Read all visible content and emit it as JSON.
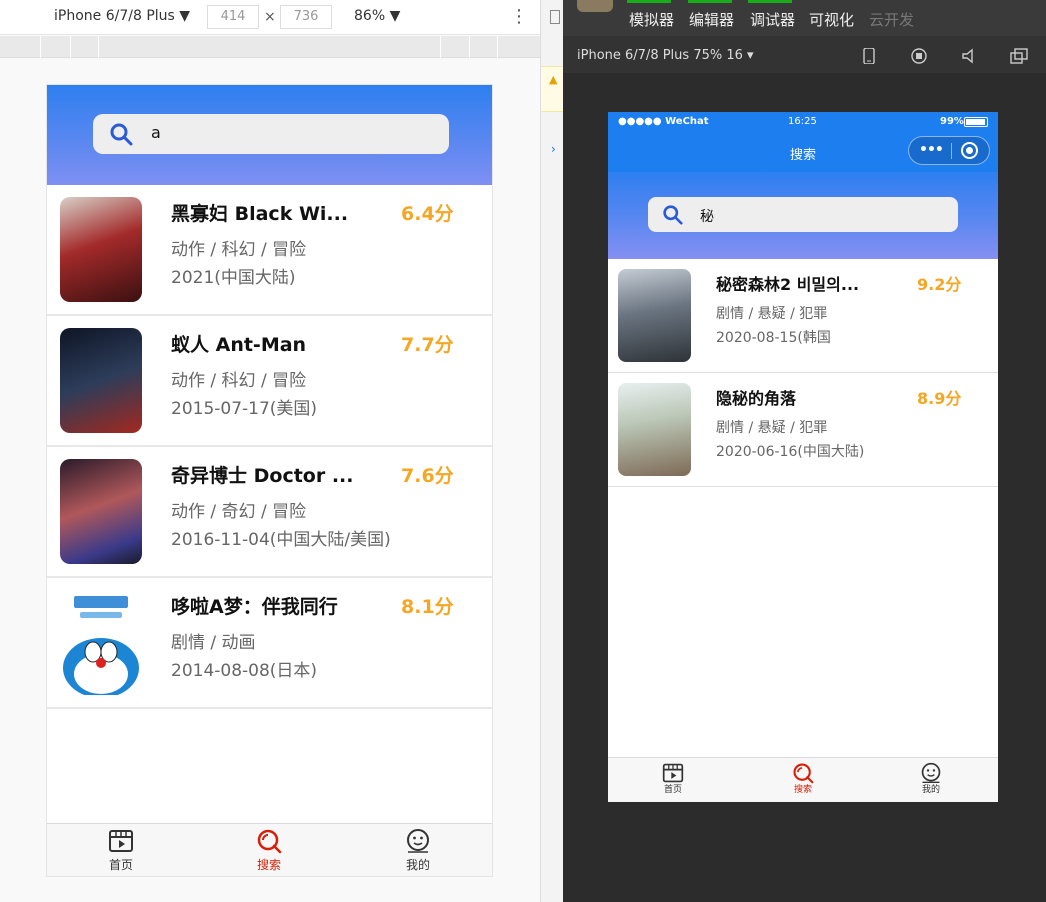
{
  "devtools": {
    "device": "iPhone 6/7/8 Plus ▼",
    "width": "414",
    "height": "736",
    "times": "×",
    "zoom": "86% ▼",
    "more": "⋮"
  },
  "simulator_left": {
    "search_query": "a",
    "movies": [
      {
        "title": "黑寡妇 Black Wi...",
        "score": "6.4分",
        "genre": "动作 / 科幻 / 冒险",
        "date": "2021(中国大陆)",
        "poster_color": "#7a1f1f"
      },
      {
        "title": "蚁人 Ant-Man",
        "score": "7.7分",
        "genre": "动作 / 科幻 / 冒险",
        "date": "2015-07-17(美国)",
        "poster_color": "#1b2233"
      },
      {
        "title": "奇异博士 Doctor ...",
        "score": "7.6分",
        "genre": "动作 / 奇幻 / 冒险",
        "date": "2016-11-04(中国大陆/美国)",
        "poster_color": "#3a2a4a"
      },
      {
        "title": "哆啦A梦：伴我同行",
        "score": "8.1分",
        "genre": "剧情 / 动画",
        "date": "2014-08-08(日本)",
        "poster_color": "#3f8fd8"
      }
    ]
  },
  "tabs": [
    {
      "label": "首页",
      "icon": "film-icon"
    },
    {
      "label": "搜索",
      "icon": "search-icon"
    },
    {
      "label": "我的",
      "icon": "smile-icon"
    }
  ],
  "wechat_ide": {
    "menu": [
      "模拟器",
      "编辑器",
      "调试器",
      "可视化",
      "云开发"
    ],
    "model": "iPhone 6/7/8 Plus 75% 16 ▾"
  },
  "simulator_right": {
    "status_carrier": "●●●●● WeChat",
    "status_time": "16:25",
    "status_battery": "99%",
    "nav_title": "搜索",
    "capsule_dots": "•••",
    "search_query": "秘",
    "movies": [
      {
        "title": "秘密森林2 비밀의...",
        "score": "9.2分",
        "genre": "剧情 / 悬疑 / 犯罪",
        "date": "2020-08-15(韩国",
        "poster_color": "#5a6470"
      },
      {
        "title": "隐秘的角落",
        "score": "8.9分",
        "genre": "剧情 / 悬疑 / 犯罪",
        "date": "2020-06-16(中国大陆)",
        "poster_color": "#9aa88a"
      }
    ]
  },
  "colors": {
    "accent_blue": "#1d7ef0",
    "score_orange": "#f5a623",
    "active_tab_red": "#d81e06"
  }
}
